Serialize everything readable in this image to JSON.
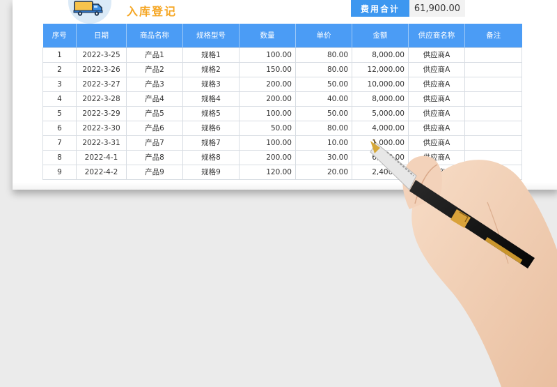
{
  "header": {
    "title": "入库登记",
    "total_label": "费用合计",
    "total_value": "61,900.00"
  },
  "colors": {
    "header_blue": "#4b9cf5",
    "title_orange": "#f5a623",
    "label_blue": "#3d97f0"
  },
  "icons": {
    "logo": "delivery-truck-icon"
  },
  "table": {
    "columns": [
      "序号",
      "日期",
      "商品名称",
      "规格型号",
      "数量",
      "单价",
      "金额",
      "供应商名称",
      "备注"
    ],
    "rows": [
      [
        "1",
        "2022-3-25",
        "产品1",
        "规格1",
        "100.00",
        "80.00",
        "8,000.00",
        "供应商A",
        ""
      ],
      [
        "2",
        "2022-3-26",
        "产品2",
        "规格2",
        "150.00",
        "80.00",
        "12,000.00",
        "供应商A",
        ""
      ],
      [
        "3",
        "2022-3-27",
        "产品3",
        "规格3",
        "200.00",
        "50.00",
        "10,000.00",
        "供应商A",
        ""
      ],
      [
        "4",
        "2022-3-28",
        "产品4",
        "规格4",
        "200.00",
        "40.00",
        "8,000.00",
        "供应商A",
        ""
      ],
      [
        "5",
        "2022-3-29",
        "产品5",
        "规格5",
        "100.00",
        "50.00",
        "5,000.00",
        "供应商A",
        ""
      ],
      [
        "6",
        "2022-3-30",
        "产品6",
        "规格6",
        "50.00",
        "80.00",
        "4,000.00",
        "供应商A",
        ""
      ],
      [
        "7",
        "2022-3-31",
        "产品7",
        "规格7",
        "100.00",
        "10.00",
        "1,000.00",
        "供应商A",
        ""
      ],
      [
        "8",
        "2022-4-1",
        "产品8",
        "规格8",
        "200.00",
        "30.00",
        "6,000.00",
        "供应商A",
        ""
      ],
      [
        "9",
        "2022-4-2",
        "产品9",
        "规格9",
        "120.00",
        "20.00",
        "2,400.00",
        "供应商A",
        ""
      ]
    ]
  }
}
